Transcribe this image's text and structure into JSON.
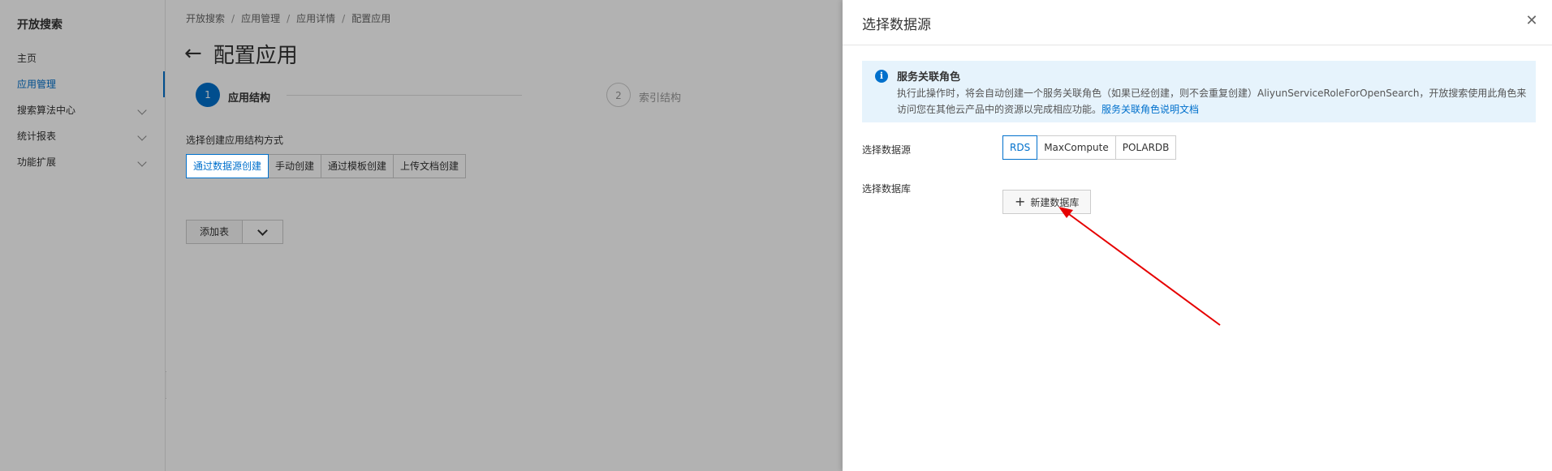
{
  "sidebar": {
    "title": "开放搜索",
    "items": [
      {
        "label": "主页"
      },
      {
        "label": "应用管理"
      },
      {
        "label": "搜索算法中心"
      },
      {
        "label": "统计报表"
      },
      {
        "label": "功能扩展"
      }
    ]
  },
  "breadcrumb": [
    "开放搜索",
    "应用管理",
    "应用详情",
    "配置应用"
  ],
  "page": {
    "title": "配置应用",
    "steps": [
      {
        "number": "1",
        "label": "应用结构"
      },
      {
        "number": "2",
        "label": "索引结构"
      }
    ],
    "method_label": "选择创建应用结构方式",
    "methods": [
      "通过数据源创建",
      "手动创建",
      "通过模板创建",
      "上传文档创建"
    ],
    "add_table": "添加表"
  },
  "drawer": {
    "title": "选择数据源",
    "close_icon": "close-icon",
    "notice": {
      "icon": "info-icon",
      "title": "服务关联角色",
      "body": "执行此操作时，将会自动创建一个服务关联角色（如果已经创建，则不会重复创建）AliyunServiceRoleForOpenSearch，开放搜索使用此角色来访问您在其他云产品中的资源以完成相应功能。",
      "link": "服务关联角色说明文档"
    },
    "datasource_label": "选择数据源",
    "datasources": [
      "RDS",
      "MaxCompute",
      "POLARDB"
    ],
    "database_label": "选择数据库",
    "new_db_button": "新建数据库"
  },
  "colors": {
    "accent": "#0070cc",
    "notice_bg": "#e6f3fc",
    "annotation_arrow": "#e60000"
  }
}
